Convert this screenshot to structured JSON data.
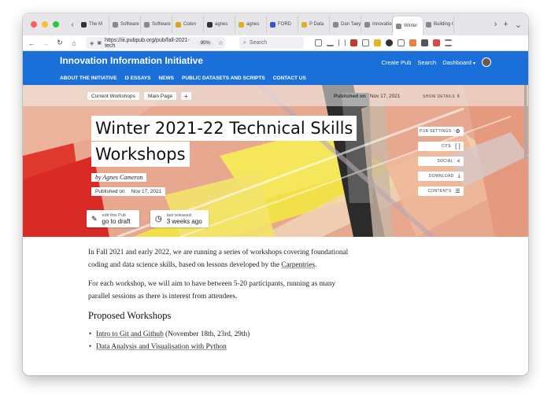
{
  "browser": {
    "tabs": [
      {
        "label": "The M",
        "color": "#333333"
      },
      {
        "label": "Software",
        "color": "#888888"
      },
      {
        "label": "Software",
        "color": "#888888"
      },
      {
        "label": "Coten",
        "color": "#e0a020"
      },
      {
        "label": "agnes",
        "color": "#333333"
      },
      {
        "label": "agnes",
        "color": "#e0b020"
      },
      {
        "label": "FORD",
        "color": "#3a55c8"
      },
      {
        "label": "P Data",
        "color": "#e0b020"
      },
      {
        "label": "Dan Taeyo",
        "color": "#888888"
      },
      {
        "label": "Innovation",
        "color": "#888888"
      },
      {
        "label": "Winter",
        "color": "#888888",
        "active": true
      },
      {
        "label": "Building t",
        "color": "#888888"
      }
    ],
    "tab_close": "×",
    "url": "https://iii.pubpub.org/pub/fall-2021-tech",
    "zoom": "90%",
    "search_placeholder": "Search"
  },
  "site": {
    "title": "Innovation Information Initiative",
    "header_links": {
      "create": "Create Pub",
      "search": "Search",
      "dashboard": "Dashboard"
    },
    "nav": [
      "ABOUT THE INITIATIVE",
      "I3 ESSAYS",
      "NEWS",
      "PUBLIC DATASETS AND SCRIPTS",
      "CONTACT US"
    ]
  },
  "pub": {
    "collection_pill": "Current Workshops",
    "main_page_pill": "Main Page",
    "add_label": "+",
    "published_label": "Published on",
    "published_date": "Nov 17, 2021",
    "show_details": "SHOW DETAILS",
    "title_line1": "Winter 2021-22 Technical Skills",
    "title_line2": "Workshops",
    "byline": "by Agnes Cameron",
    "pubdate_label": "Published on",
    "pubdate_value": "Nov 17, 2021",
    "edit_small": "edit this Pub",
    "edit_big": "go to draft",
    "released_small": "last released",
    "released_big": "3 weeks ago",
    "side_buttons": {
      "settings": "PUB SETTINGS",
      "cite": "CITE",
      "social": "SOCIAL",
      "download": "DOWNLOAD",
      "contents": "CONTENTS"
    }
  },
  "article": {
    "p1_before": "In Fall 2021 and early 2022, we are running a series of workshops covering foundational coding and data science skills, based on lessons developed by the ",
    "p1_link": "Carpentries",
    "p1_after": ".",
    "p2": "For each workshop, we will aim to have between 5-20 participants, running as many parallel sessions as there is interest from attendees.",
    "heading": "Proposed Workshops",
    "item1_link": "Intro to Git and Github",
    "item1_rest": " (November 18th, 23rd, 29th)",
    "item2_link": "Data Analysis and Visualisation with Python"
  },
  "colors": {
    "header_blue": "#1a6fd8",
    "tab_bar": "#e6e5ea"
  }
}
